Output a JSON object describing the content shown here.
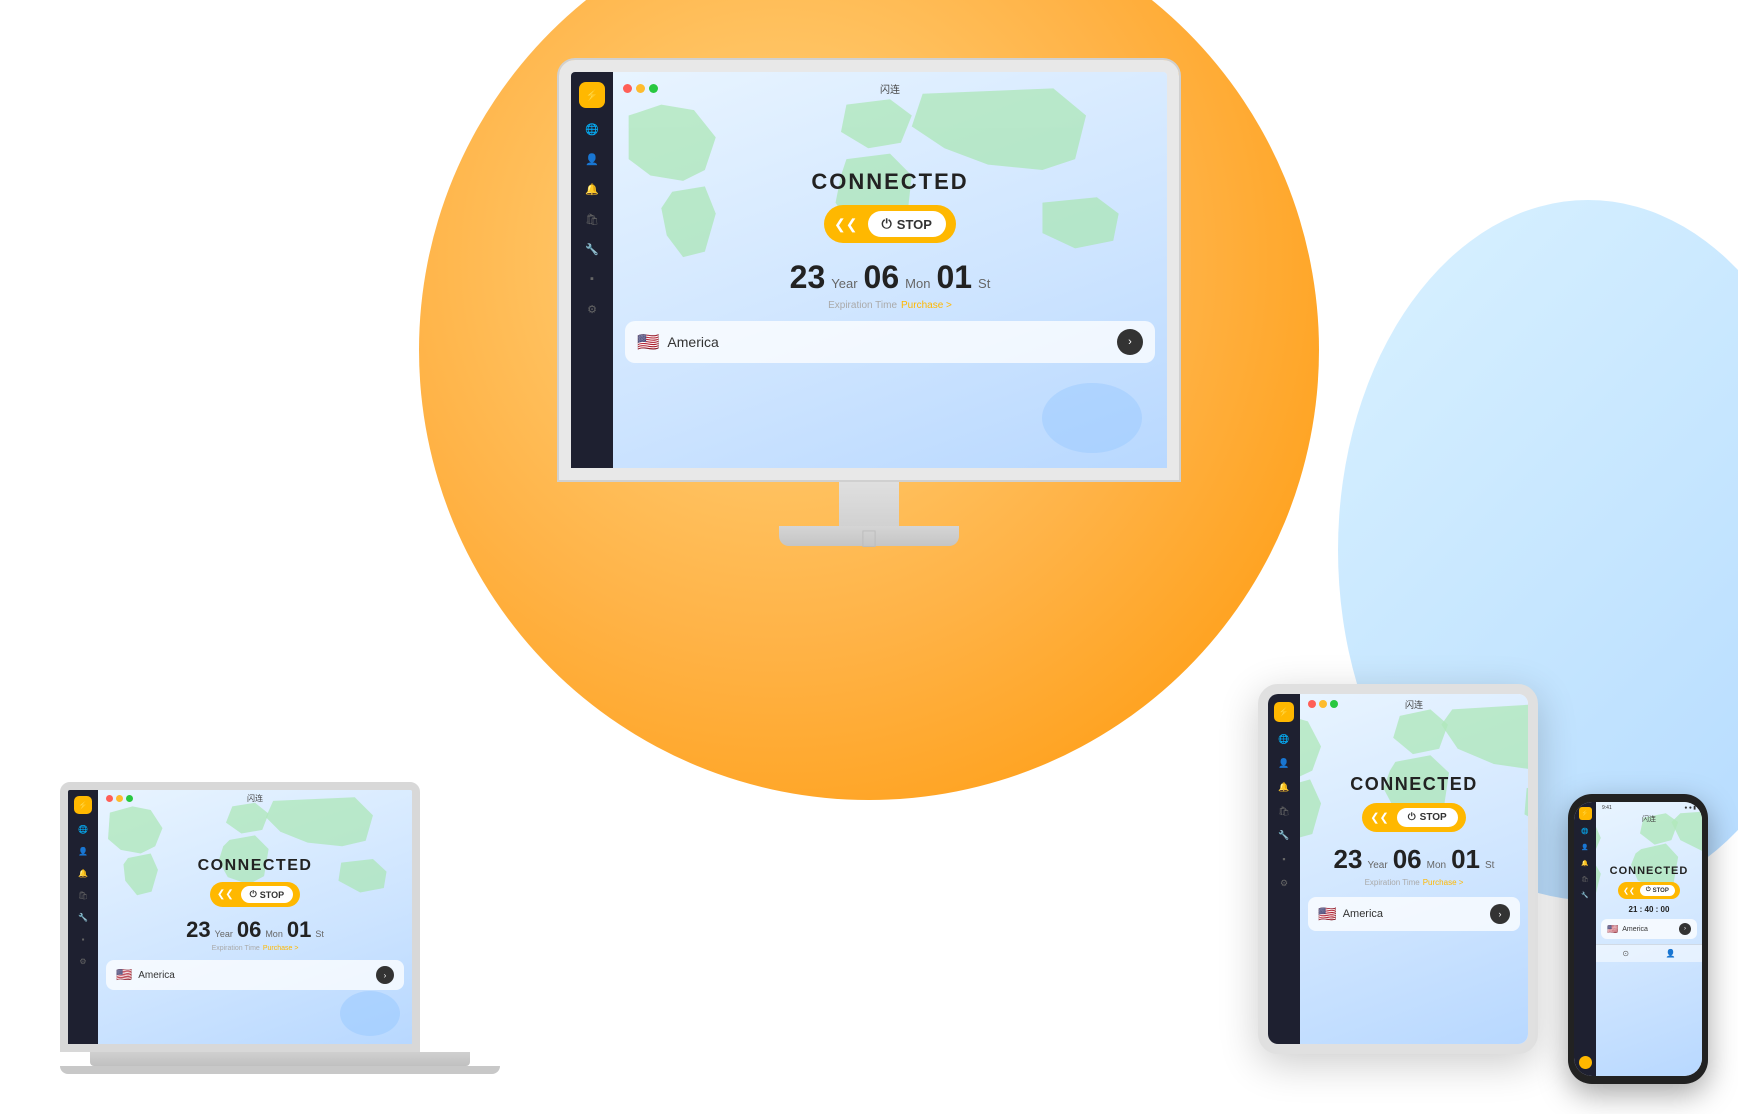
{
  "app": {
    "name": "闪连",
    "status": "CONNECTED",
    "stop_label": "STOP",
    "expiry_label": "Expiration Time",
    "purchase_label": "Purchase >",
    "location": "America",
    "time": {
      "year": "23",
      "year_unit": "Year",
      "month": "06",
      "month_unit": "Mon",
      "day": "01",
      "day_unit": "St"
    },
    "phone_time": "21 : 40 : 00"
  },
  "monitor": {
    "title": "闪连",
    "connected": "CONNECTED",
    "stop": "STOP",
    "year": "23",
    "year_unit": "Year",
    "month": "06",
    "month_unit": "Mon",
    "day": "01",
    "day_unit": "St",
    "expiry": "Expiration Time",
    "purchase": "Purchase >",
    "location": "America"
  },
  "laptop": {
    "title": "闪连",
    "connected": "CONNECTED",
    "stop": "STOP",
    "year": "23",
    "year_unit": "Year",
    "month": "06",
    "month_unit": "Mon",
    "day": "01",
    "day_unit": "St",
    "expiry": "Expiration Time",
    "purchase": "Purchase >",
    "location": "America"
  },
  "tablet": {
    "title": "闪连",
    "connected": "CONNECTED",
    "stop": "STOP",
    "year": "23",
    "year_unit": "Year",
    "month": "06",
    "month_unit": "Mon",
    "day": "01",
    "day_unit": "St",
    "expiry": "Expiration Time",
    "purchase": "Purchase >",
    "location": "America"
  },
  "phone": {
    "title": "闪连",
    "connected": "CONNECTED",
    "stop": "STOP",
    "timer": "21 : 40 : 00",
    "location": "America"
  }
}
